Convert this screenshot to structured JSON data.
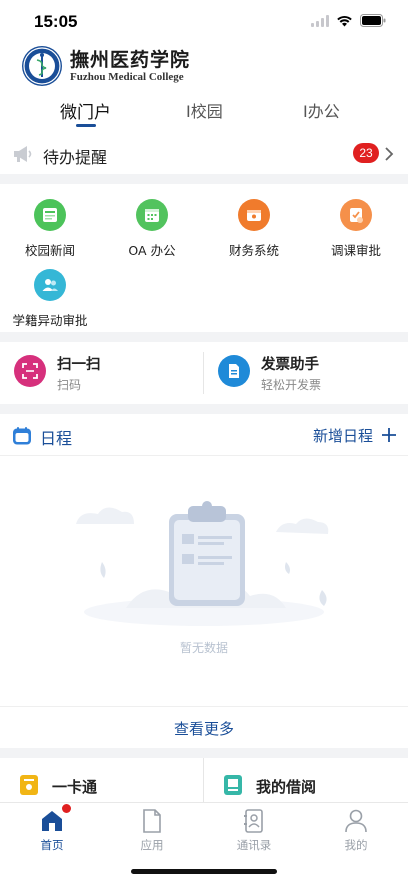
{
  "status_bar": {
    "time": "15:05"
  },
  "brand": {
    "name_cn": "撫州医药学院",
    "name_en": "Fuzhou Medical College"
  },
  "top_tabs": [
    {
      "label": "微门户",
      "active": true
    },
    {
      "label": "I校园",
      "active": false
    },
    {
      "label": "I办公",
      "active": false
    }
  ],
  "todo": {
    "label": "待办提醒",
    "count": "23"
  },
  "apps": [
    {
      "label": "校园新闻",
      "icon": "news-icon",
      "color": "#4cc35a"
    },
    {
      "label": "OA 办公",
      "icon": "calendar-grid-icon",
      "color": "#52c35e"
    },
    {
      "label": "财务系统",
      "icon": "wallet-icon",
      "color": "#f07b2c"
    },
    {
      "label": "调课审批",
      "icon": "approval-icon",
      "color": "#f5904a"
    },
    {
      "label": "学籍异动审批",
      "icon": "users-icon",
      "color": "#35b7d6"
    }
  ],
  "quick": [
    {
      "title": "扫一扫",
      "subtitle": "扫码",
      "icon": "scan-icon",
      "color": "#d6307c"
    },
    {
      "title": "发票助手",
      "subtitle": "轻松开发票",
      "icon": "invoice-icon",
      "color": "#1f8ad8"
    }
  ],
  "schedule": {
    "title": "日程",
    "add_label": "新增日程",
    "empty_text": "暂无数据",
    "more_label": "查看更多"
  },
  "cards": [
    {
      "title": "一卡通",
      "icon": "card-icon",
      "color": "#f1b515"
    },
    {
      "title": "我的借阅",
      "icon": "book-icon",
      "color": "#36b7a8"
    }
  ],
  "tabbar": [
    {
      "label": "首页",
      "icon": "home-icon",
      "active": true,
      "dot": true
    },
    {
      "label": "应用",
      "icon": "document-icon",
      "active": false
    },
    {
      "label": "通讯录",
      "icon": "contacts-icon",
      "active": false
    },
    {
      "label": "我的",
      "icon": "person-icon",
      "active": false
    }
  ],
  "colors": {
    "accent": "#1a4e98",
    "badge": "#e02020",
    "page_bg": "#f2f3f5"
  }
}
